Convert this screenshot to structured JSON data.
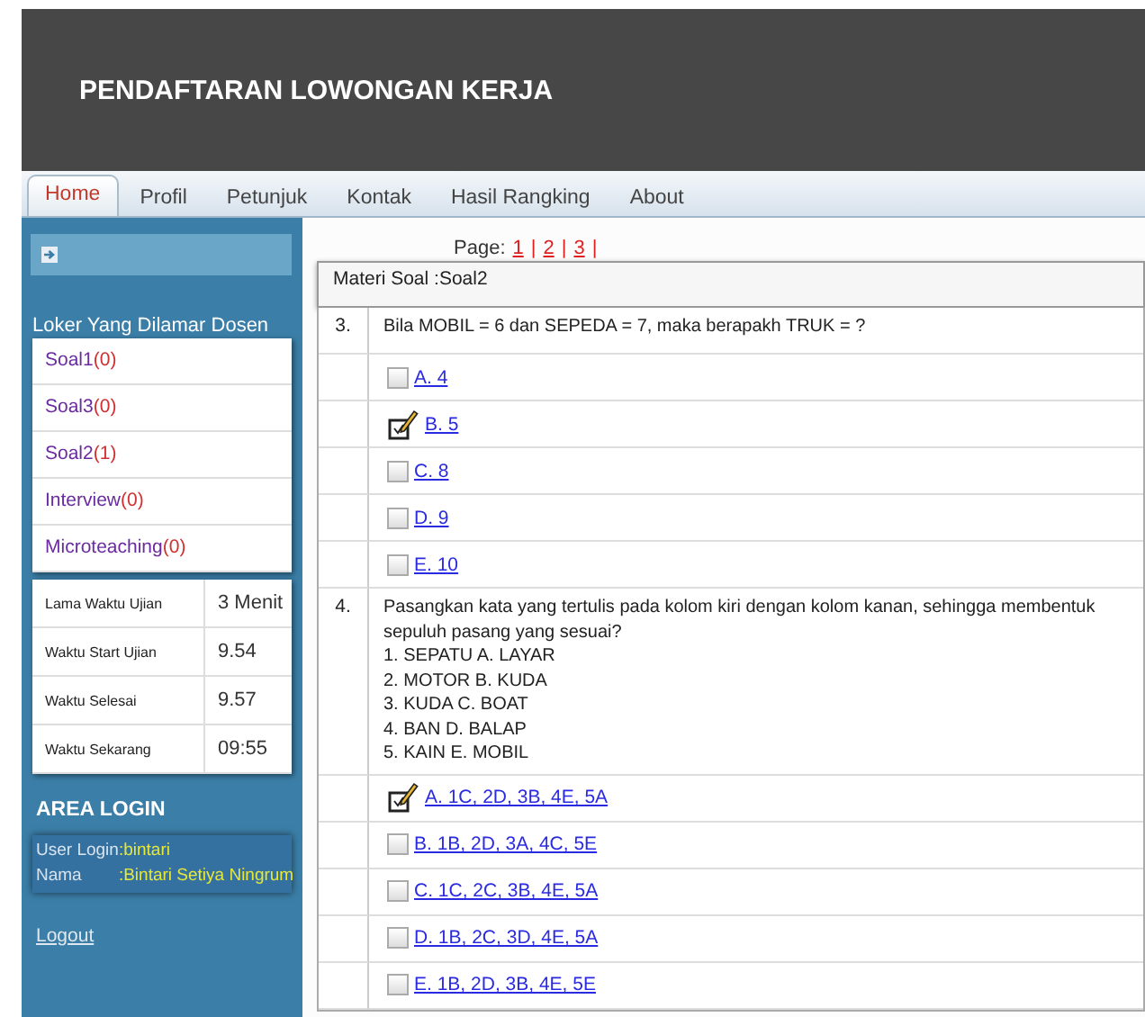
{
  "header": {
    "title": "PENDAFTARAN LOWONGAN KERJA"
  },
  "tabs": [
    {
      "label": "Home",
      "selected": true
    },
    {
      "label": "Profil",
      "selected": false
    },
    {
      "label": "Petunjuk",
      "selected": false
    },
    {
      "label": "Kontak",
      "selected": false
    },
    {
      "label": "Hasil Rangking",
      "selected": false
    },
    {
      "label": "About",
      "selected": false
    }
  ],
  "sidebar": {
    "heading": "Loker Yang Dilamar Dosen",
    "items": [
      {
        "name": "Soal1",
        "count": "(0)"
      },
      {
        "name": "Soal3",
        "count": "(0)"
      },
      {
        "name": "Soal2",
        "count": "(1)"
      },
      {
        "name": "Interview",
        "count": "(0)"
      },
      {
        "name": "Microteaching",
        "count": "(0)"
      }
    ],
    "times": [
      {
        "label": "Lama Waktu Ujian",
        "value": "3 Menit"
      },
      {
        "label": "Waktu Start Ujian",
        "value": "9.54"
      },
      {
        "label": "Waktu Selesai",
        "value": "9.57"
      },
      {
        "label": "Waktu Sekarang",
        "value": "09:55"
      }
    ],
    "login_heading": "AREA LOGIN",
    "login": [
      {
        "label": "User Login",
        "value": ":bintari"
      },
      {
        "label": "Nama",
        "value": ":Bintari Setiya Ningrum"
      }
    ],
    "logout": "Logout"
  },
  "pagination": {
    "label": "Page:",
    "pages": [
      "1",
      "2",
      "3"
    ],
    "separator": "|"
  },
  "materi": "Materi Soal :Soal2",
  "questions": [
    {
      "number": "3.",
      "text": "Bila MOBIL = 6 dan SEPEDA = 7, maka berapakh TRUK = ?",
      "options": [
        {
          "label": "A. 4",
          "selected": false
        },
        {
          "label": "B. 5",
          "selected": true
        },
        {
          "label": "C. 8",
          "selected": false
        },
        {
          "label": "D. 9",
          "selected": false
        },
        {
          "label": "E. 10",
          "selected": false
        }
      ]
    },
    {
      "number": "4.",
      "text": "Pasangkan kata yang tertulis pada kolom kiri dengan kolom kanan, sehingga membentuk sepuluh pasang yang sesuai?",
      "lines": [
        "1. SEPATU A. LAYAR",
        "2. MOTOR B. KUDA",
        "3. KUDA C. BOAT",
        "4. BAN D. BALAP",
        "5. KAIN E. MOBIL"
      ],
      "options": [
        {
          "label": "A. 1C, 2D, 3B, 4E, 5A",
          "selected": true
        },
        {
          "label": "B. 1B, 2D, 3A, 4C, 5E",
          "selected": false
        },
        {
          "label": "C. 1C, 2C, 3B, 4E, 5A",
          "selected": false
        },
        {
          "label": "D. 1B, 2C, 3D, 4E, 5A",
          "selected": false
        },
        {
          "label": "E. 1B, 2D, 3B, 4E, 5E",
          "selected": false
        }
      ]
    }
  ]
}
